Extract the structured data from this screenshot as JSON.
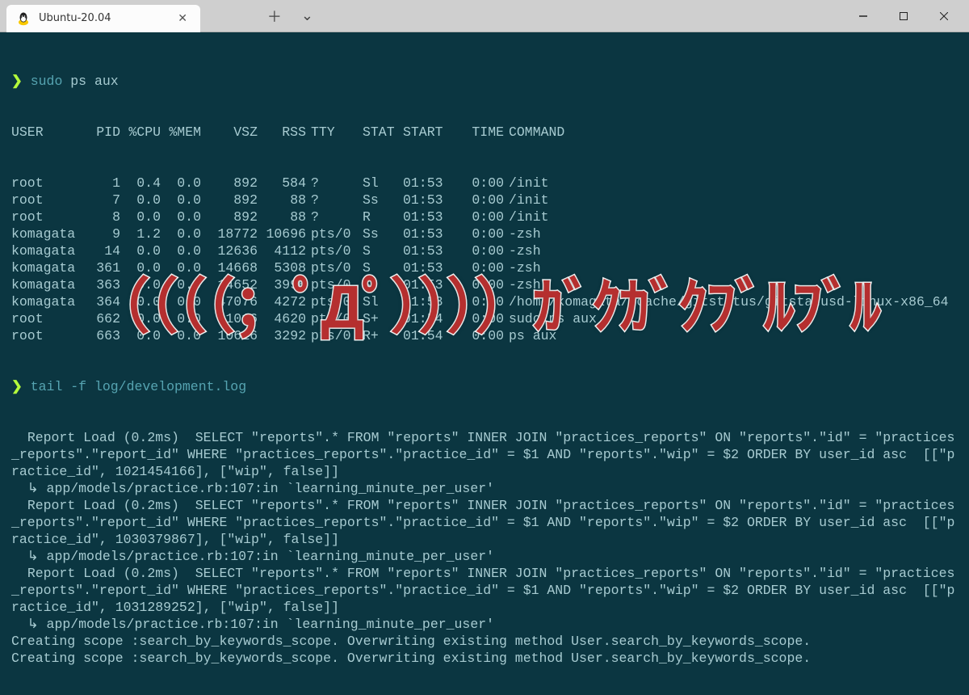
{
  "window": {
    "tab_title": "Ubuntu-20.04"
  },
  "commands": {
    "ps": {
      "bin": "sudo",
      "args": "ps aux"
    },
    "tail": {
      "bin": "tail",
      "flag": "-f",
      "path": "log/development.log"
    }
  },
  "ps_header": {
    "user": "USER",
    "pid": "PID",
    "cpu": "%CPU",
    "mem": "%MEM",
    "vsz": "VSZ",
    "rss": "RSS",
    "tty": "TTY",
    "stat": "STAT",
    "start": "START",
    "time": "TIME",
    "command": "COMMAND"
  },
  "ps_rows": [
    {
      "user": "root",
      "pid": "1",
      "cpu": "0.4",
      "mem": "0.0",
      "vsz": "892",
      "rss": "584",
      "tty": "?",
      "stat": "Sl",
      "start": "01:53",
      "time": "0:00",
      "command": "/init"
    },
    {
      "user": "root",
      "pid": "7",
      "cpu": "0.0",
      "mem": "0.0",
      "vsz": "892",
      "rss": "88",
      "tty": "?",
      "stat": "Ss",
      "start": "01:53",
      "time": "0:00",
      "command": "/init"
    },
    {
      "user": "root",
      "pid": "8",
      "cpu": "0.0",
      "mem": "0.0",
      "vsz": "892",
      "rss": "88",
      "tty": "?",
      "stat": "R",
      "start": "01:53",
      "time": "0:00",
      "command": "/init"
    },
    {
      "user": "komagata",
      "pid": "9",
      "cpu": "1.2",
      "mem": "0.0",
      "vsz": "18772",
      "rss": "10696",
      "tty": "pts/0",
      "stat": "Ss",
      "start": "01:53",
      "time": "0:00",
      "command": "-zsh"
    },
    {
      "user": "komagata",
      "pid": "14",
      "cpu": "0.0",
      "mem": "0.0",
      "vsz": "12636",
      "rss": "4112",
      "tty": "pts/0",
      "stat": "S",
      "start": "01:53",
      "time": "0:00",
      "command": "-zsh"
    },
    {
      "user": "komagata",
      "pid": "361",
      "cpu": "0.0",
      "mem": "0.0",
      "vsz": "14668",
      "rss": "5308",
      "tty": "pts/0",
      "stat": "S",
      "start": "01:53",
      "time": "0:00",
      "command": "-zsh"
    },
    {
      "user": "komagata",
      "pid": "363",
      "cpu": "0.0",
      "mem": "0.0",
      "vsz": "14652",
      "rss": "3996",
      "tty": "pts/0",
      "stat": "S",
      "start": "01:53",
      "time": "0:00",
      "command": "-zsh"
    },
    {
      "user": "komagata",
      "pid": "364",
      "cpu": "0.0",
      "mem": "0.0",
      "vsz": "47076",
      "rss": "4272",
      "tty": "pts/0",
      "stat": "Sl",
      "start": "01:53",
      "time": "0:00",
      "command": "/home/komagata/.cache/gitstatus/gitstatusd-linux-x86_64"
    },
    {
      "user": "root",
      "pid": "662",
      "cpu": "0.0",
      "mem": "0.0",
      "vsz": "11016",
      "rss": "4620",
      "tty": "pts/0",
      "stat": "S+",
      "start": "01:54",
      "time": "0:00",
      "command": "sudo ps aux"
    },
    {
      "user": "root",
      "pid": "663",
      "cpu": "0.0",
      "mem": "0.0",
      "vsz": "10616",
      "rss": "3292",
      "tty": "pts/0",
      "stat": "R+",
      "start": "01:54",
      "time": "0:00",
      "command": "ps aux"
    }
  ],
  "log_lines": [
    "  Report Load (0.2ms)  SELECT \"reports\".* FROM \"reports\" INNER JOIN \"practices_reports\" ON \"reports\".\"id\" = \"practices_reports\".\"report_id\" WHERE \"practices_reports\".\"practice_id\" = $1 AND \"reports\".\"wip\" = $2 ORDER BY user_id asc  [[\"practice_id\", 1021454166], [\"wip\", false]]",
    "  ↳ app/models/practice.rb:107:in `learning_minute_per_user'",
    "  Report Load (0.2ms)  SELECT \"reports\".* FROM \"reports\" INNER JOIN \"practices_reports\" ON \"reports\".\"id\" = \"practices_reports\".\"report_id\" WHERE \"practices_reports\".\"practice_id\" = $1 AND \"reports\".\"wip\" = $2 ORDER BY user_id asc  [[\"practice_id\", 1030379867], [\"wip\", false]]",
    "  ↳ app/models/practice.rb:107:in `learning_minute_per_user'",
    "  Report Load (0.2ms)  SELECT \"reports\".* FROM \"reports\" INNER JOIN \"practices_reports\" ON \"reports\".\"id\" = \"practices_reports\".\"report_id\" WHERE \"practices_reports\".\"practice_id\" = $1 AND \"reports\".\"wip\" = $2 ORDER BY user_id asc  [[\"practice_id\", 1031289252], [\"wip\", false]]",
    "  ↳ app/models/practice.rb:107:in `learning_minute_per_user'",
    "Creating scope :search_by_keywords_scope. Overwriting existing method User.search_by_keywords_scope.",
    "Creating scope :search_by_keywords_scope. Overwriting existing method User.search_by_keywords_scope."
  ],
  "overlay_text": "（（（（；ﾟДﾟ））））ｶﾞｸｶﾞｸﾌﾞﾙﾌﾞﾙ"
}
